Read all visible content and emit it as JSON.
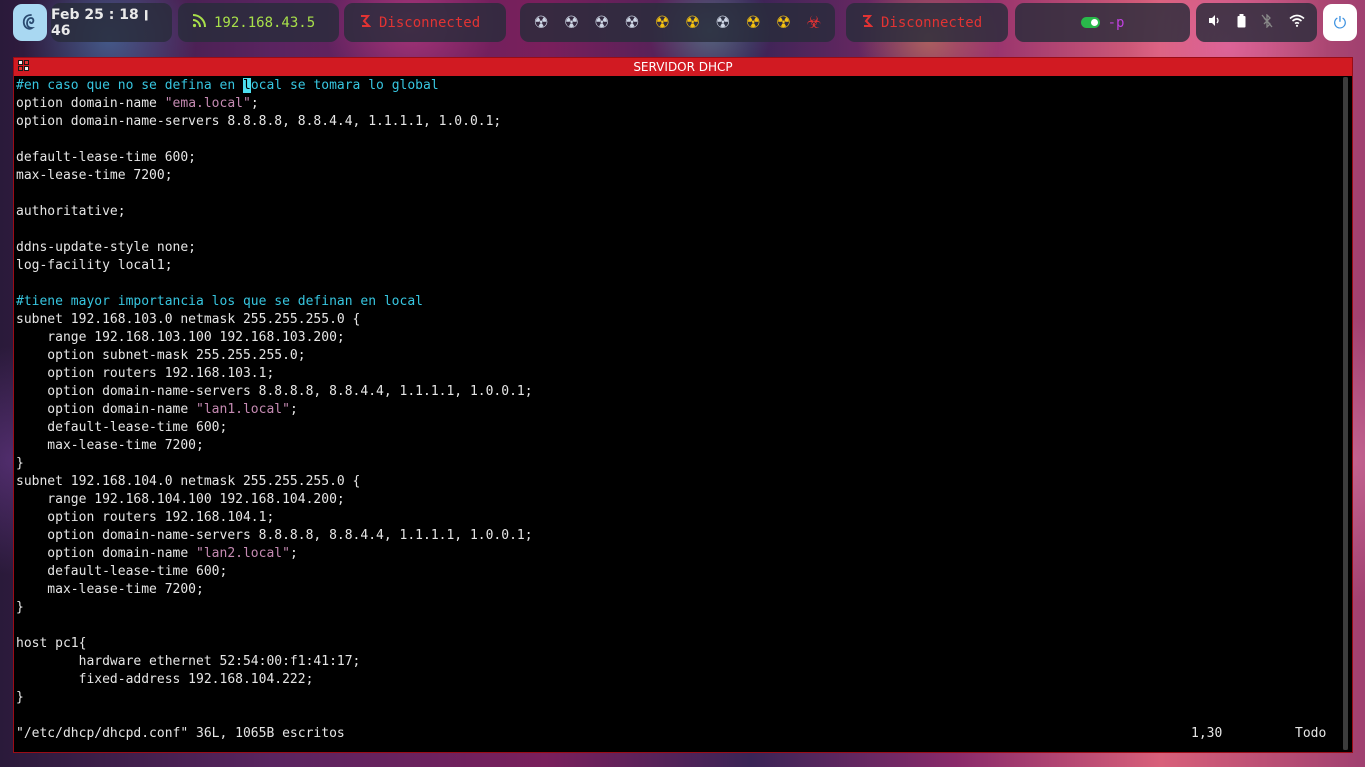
{
  "topbar": {
    "clock": "Feb 25 ׀ 18 : 46",
    "ip": "192.168.43.5",
    "vpn_left": "Disconnected",
    "vpn_right": "Disconnected",
    "mode": "-p",
    "workspace_icons": [
      "☢",
      "☢",
      "☢",
      "☢",
      "☢",
      "☢",
      "☢",
      "☢",
      "☢",
      "☣"
    ],
    "workspace_colors": [
      "#cfd7e6",
      "#cfd7e6",
      "#cfd7e6",
      "#cfd7e6",
      "#f5c211",
      "#f5c211",
      "#cfd7e6",
      "#f5c211",
      "#f5c211",
      "#e23333"
    ]
  },
  "window": {
    "title": "SERVIDOR DHCP"
  },
  "editor": {
    "lines": [
      [
        {
          "t": "#en caso que no se defina en ",
          "c": "c"
        },
        {
          "t": "l",
          "c": "cur"
        },
        {
          "t": "ocal se tomara lo global",
          "c": "c"
        }
      ],
      [
        {
          "t": "option domain-name "
        },
        {
          "t": "\"ema.local\"",
          "c": "s"
        },
        {
          "t": ";"
        }
      ],
      [
        {
          "t": "option domain-name-servers 8.8.8.8, 8.8.4.4, 1.1.1.1, 1.0.0.1;"
        }
      ],
      [],
      [
        {
          "t": "default-lease-time 600;"
        }
      ],
      [
        {
          "t": "max-lease-time 7200;"
        }
      ],
      [],
      [
        {
          "t": "authoritative;"
        }
      ],
      [],
      [
        {
          "t": "ddns-update-style none;"
        }
      ],
      [
        {
          "t": "log-facility local1;"
        }
      ],
      [],
      [
        {
          "t": "#tiene mayor importancia los que se definan en local",
          "c": "c"
        }
      ],
      [
        {
          "t": "subnet 192.168.103.0 netmask 255.255.255.0 {"
        }
      ],
      [
        {
          "t": "    range 192.168.103.100 192.168.103.200;"
        }
      ],
      [
        {
          "t": "    option subnet-mask 255.255.255.0;"
        }
      ],
      [
        {
          "t": "    option routers 192.168.103.1;"
        }
      ],
      [
        {
          "t": "    option domain-name-servers 8.8.8.8, 8.8.4.4, 1.1.1.1, 1.0.0.1;"
        }
      ],
      [
        {
          "t": "    option domain-name "
        },
        {
          "t": "\"lan1.local\"",
          "c": "s"
        },
        {
          "t": ";"
        }
      ],
      [
        {
          "t": "    default-lease-time 600;"
        }
      ],
      [
        {
          "t": "    max-lease-time 7200;"
        }
      ],
      [
        {
          "t": "}"
        }
      ],
      [
        {
          "t": "subnet 192.168.104.0 netmask 255.255.255.0 {"
        }
      ],
      [
        {
          "t": "    range 192.168.104.100 192.168.104.200;"
        }
      ],
      [
        {
          "t": "    option routers 192.168.104.1;"
        }
      ],
      [
        {
          "t": "    option domain-name-servers 8.8.8.8, 8.8.4.4, 1.1.1.1, 1.0.0.1;"
        }
      ],
      [
        {
          "t": "    option domain-name "
        },
        {
          "t": "\"lan2.local\"",
          "c": "s"
        },
        {
          "t": ";"
        }
      ],
      [
        {
          "t": "    default-lease-time 600;"
        }
      ],
      [
        {
          "t": "    max-lease-time 7200;"
        }
      ],
      [
        {
          "t": "}"
        }
      ],
      [],
      [
        {
          "t": "host pc1{"
        }
      ],
      [
        {
          "t": "        hardware ethernet 52:54:00:f1:41:17;"
        }
      ],
      [
        {
          "t": "        fixed-address 192.168.104.222;"
        }
      ],
      [
        {
          "t": "}"
        }
      ]
    ],
    "status_message": "\"/etc/dhcp/dhcpd.conf\" 36L, 1065B escritos",
    "cursor_position": "1,30",
    "scroll_position": "Todo",
    "colors": {
      "comment": "#37c6e0",
      "string": "#c58ab2",
      "cursor": "#4de0f0",
      "text": "#e6e6e6"
    }
  }
}
